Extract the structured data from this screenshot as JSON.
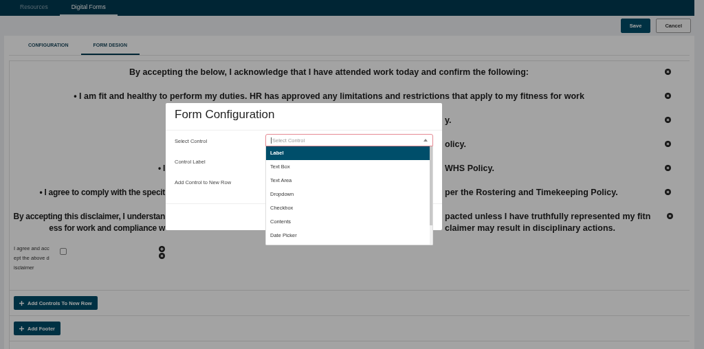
{
  "nav": {
    "tabs": [
      {
        "label": "Resources",
        "selected": false
      },
      {
        "label": "Digital Forms",
        "selected": true
      }
    ]
  },
  "actions": {
    "save": "Save",
    "cancel": "Cancel"
  },
  "page_tabs": [
    {
      "label": "CONFIGURATION",
      "selected": false
    },
    {
      "label": "FORM DESIGN",
      "selected": true
    }
  ],
  "form_rows": [
    {
      "kind": "full",
      "lines": [
        "By accepting the below, I acknowledge that I have attended work today and confirm the following:"
      ]
    },
    {
      "kind": "full",
      "lines": [
        "• I am fit and healthy to perform my duties. HR has approved any limitations and restrictions that apply to my fitness for work"
      ]
    },
    {
      "kind": "split",
      "left": [],
      "right": [
        "y."
      ]
    },
    {
      "kind": "split",
      "left": [],
      "right": [
        "olicy."
      ]
    },
    {
      "kind": "split",
      "left": [
        "• I"
      ],
      "right": [
        "WHS Policy."
      ]
    },
    {
      "kind": "split",
      "left": [
        "• I agree to comply with the specit"
      ],
      "right": [
        "per the Rostering and Timekeeping Policy."
      ]
    },
    {
      "kind": "split",
      "left": [
        "By accepting this disclaimer, I understan",
        "ess for work and compliance w"
      ],
      "right": [
        "pacted unless I have truthfully represented my fitn",
        "claimer may result in disciplinary actions."
      ]
    }
  ],
  "agree": {
    "label": "I agree and accept the above disclaimer",
    "checked": false
  },
  "buttons": [
    "Add Controls To New Row",
    "Add Footer"
  ],
  "modal": {
    "title": "Form Configuration",
    "fields": [
      "Select Control",
      "Control Label",
      "Add Control to New Row"
    ],
    "select": {
      "placeholder": "Select Control",
      "options": [
        {
          "label": "Label",
          "selected": true
        },
        {
          "label": "Text Box",
          "selected": false
        },
        {
          "label": "Text Area",
          "selected": false
        },
        {
          "label": "Dropdown",
          "selected": false
        },
        {
          "label": "Checkbox",
          "selected": false
        },
        {
          "label": "Contents",
          "selected": false
        },
        {
          "label": "Date Picker",
          "selected": false
        }
      ]
    }
  }
}
